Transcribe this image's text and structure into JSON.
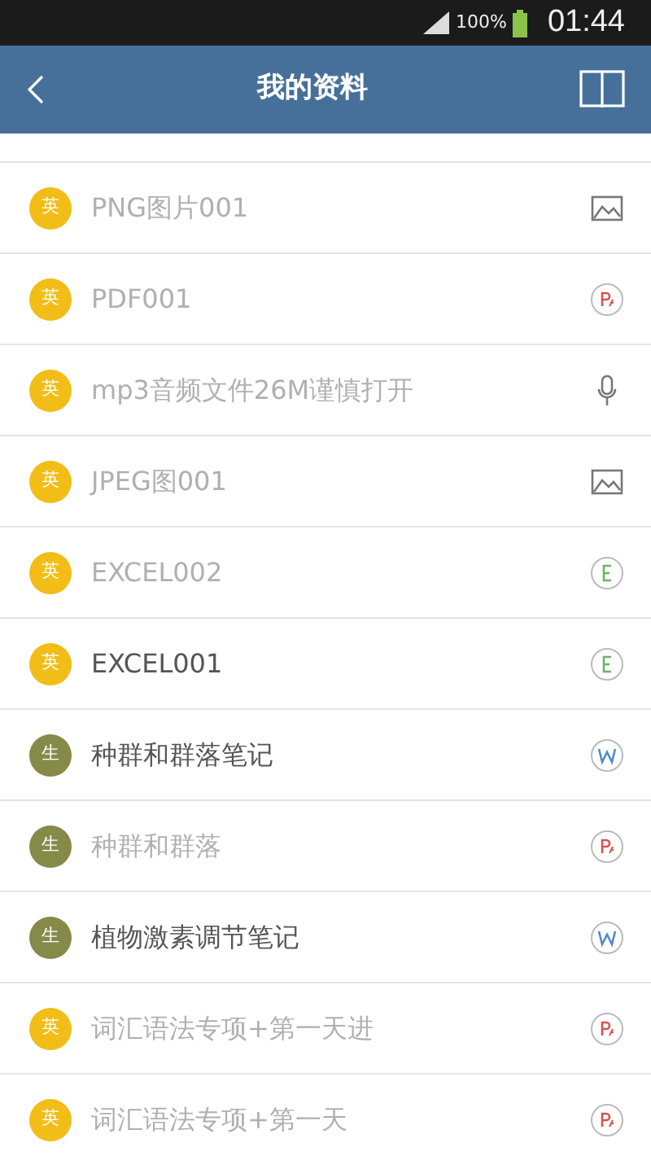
{
  "status_bar": {
    "battery": "100%",
    "time": "01:44"
  },
  "header": {
    "title": "我的资料"
  },
  "files": [
    {
      "subject": "英",
      "color": "#f2bd16",
      "name": "PNG图片001",
      "dimmed": true,
      "kind": "image"
    },
    {
      "subject": "英",
      "color": "#f2bd16",
      "name": "PDF001",
      "dimmed": true,
      "kind": "pdf"
    },
    {
      "subject": "英",
      "color": "#f2bd16",
      "name": "mp3音频文件26M谨慎打开",
      "dimmed": true,
      "kind": "audio"
    },
    {
      "subject": "英",
      "color": "#f2bd16",
      "name": "JPEG图001",
      "dimmed": true,
      "kind": "image"
    },
    {
      "subject": "英",
      "color": "#f2bd16",
      "name": "EXCEL002",
      "dimmed": true,
      "kind": "excel"
    },
    {
      "subject": "英",
      "color": "#f2bd16",
      "name": "EXCEL001",
      "dimmed": false,
      "kind": "excel"
    },
    {
      "subject": "生",
      "color": "#858a48",
      "name": "种群和群落笔记",
      "dimmed": false,
      "kind": "word"
    },
    {
      "subject": "生",
      "color": "#858a48",
      "name": "种群和群落",
      "dimmed": true,
      "kind": "pdf"
    },
    {
      "subject": "生",
      "color": "#858a48",
      "name": "植物激素调节笔记",
      "dimmed": false,
      "kind": "word"
    },
    {
      "subject": "英",
      "color": "#f2bd16",
      "name": "词汇语法专项+第一天进",
      "dimmed": true,
      "kind": "pdf"
    },
    {
      "subject": "英",
      "color": "#f2bd16",
      "name": "词汇语法专项+第一天",
      "dimmed": true,
      "kind": "pdf"
    }
  ]
}
